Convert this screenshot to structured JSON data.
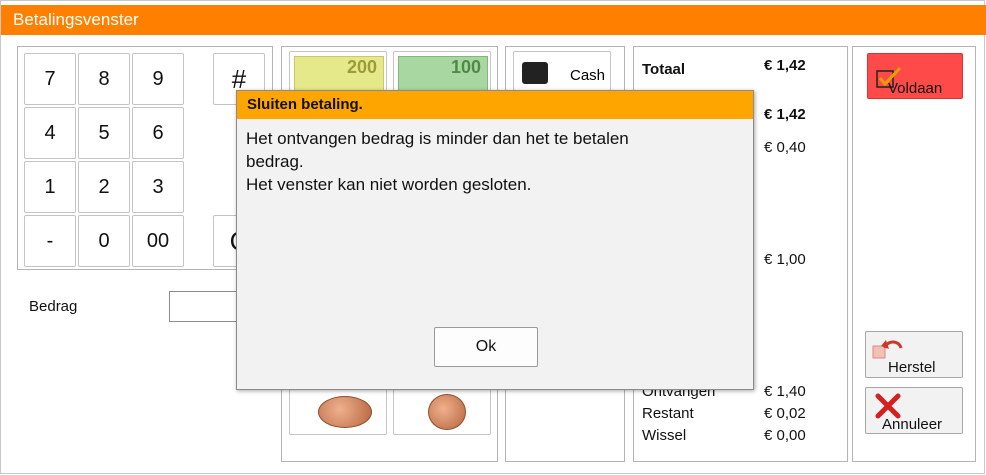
{
  "window": {
    "title": "Betalingsvenster"
  },
  "keypad": {
    "keys": [
      "7",
      "8",
      "9",
      "4",
      "5",
      "6",
      "1",
      "2",
      "3",
      "-",
      "0",
      "00"
    ],
    "extra_top": "#",
    "extra_bottom": "C"
  },
  "amount": {
    "label": "Bedrag",
    "value": ""
  },
  "payment": {
    "cash_label": "Cash",
    "banknotes": [
      "200",
      "100"
    ]
  },
  "summary": {
    "total_label": "Totaal",
    "total_value": "€ 1,42",
    "row2_value": "€ 1,42",
    "row3_value": "€ 0,40",
    "row4_value": "€ 1,00",
    "received_label": "Ontvangen",
    "received_value": "€ 1,40",
    "remaining_label": "Restant",
    "remaining_value": "€ 0,02",
    "change_label": "Wissel",
    "change_value": "€ 0,00"
  },
  "actions": {
    "voldaan_label": "Voldaan",
    "herstel_label": "Herstel",
    "annuleer_label": "Annuleer"
  },
  "dialog": {
    "title": "Sluiten betaling.",
    "message_line1": "Het ontvangen bedrag is minder dan het te betalen",
    "message_line2": "bedrag.",
    "message_line3": "Het venster kan niet worden gesloten.",
    "ok_label": "Ok"
  },
  "colors": {
    "titlebar": "#ff7f00",
    "dialog_title": "#ffa500",
    "voldaan": "#ff4a4a"
  }
}
